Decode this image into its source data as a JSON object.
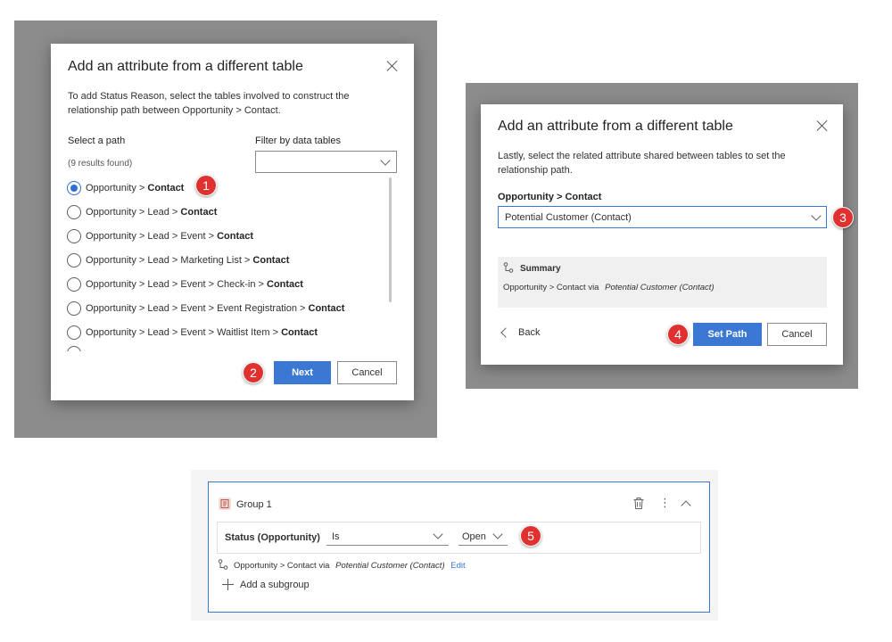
{
  "dialog1": {
    "title": "Add an attribute from a different table",
    "description_line1": "To add Status Reason, select the tables involved to construct the",
    "description_line2": "relationship path between Opportunity > Contact.",
    "select_path_label": "Select a path",
    "results_count": "(9 results found)",
    "filter_label": "Filter by data tables",
    "filter_value": "",
    "paths": [
      {
        "prefix": "Opportunity > ",
        "target": "Contact",
        "checked": true
      },
      {
        "prefix": "Opportunity > Lead > ",
        "target": "Contact",
        "checked": false
      },
      {
        "prefix": "Opportunity > Lead > Event > ",
        "target": "Contact",
        "checked": false
      },
      {
        "prefix": "Opportunity > Lead > Marketing List > ",
        "target": "Contact",
        "checked": false
      },
      {
        "prefix": "Opportunity > Lead > Event > Check-in > ",
        "target": "Contact",
        "checked": false
      },
      {
        "prefix": "Opportunity > Lead > Event > Event Registration > ",
        "target": "Contact",
        "checked": false
      },
      {
        "prefix": "Opportunity > Lead > Event > Waitlist Item > ",
        "target": "Contact",
        "checked": false
      }
    ],
    "next_label": "Next",
    "cancel_label": "Cancel"
  },
  "dialog2": {
    "title": "Add an attribute from a different table",
    "description_line1": "Lastly, select the related attribute shared between tables to set the",
    "description_line2": "relationship path.",
    "field_label": "Opportunity > Contact",
    "field_value": "Potential Customer (Contact)",
    "summary_title": "Summary",
    "summary_prefix": "Opportunity > Contact via",
    "summary_value": "Potential Customer (Contact)",
    "back_label": "Back",
    "set_path_label": "Set Path",
    "cancel_label": "Cancel"
  },
  "group": {
    "title": "Group 1",
    "field": "Status (Opportunity)",
    "operator": "Is",
    "value": "Open",
    "path_prefix": "Opportunity > Contact via",
    "path_value": "Potential Customer (Contact)",
    "edit_label": "Edit",
    "add_subgroup_label": "Add a subgroup"
  },
  "callouts": [
    "1",
    "2",
    "3",
    "4",
    "5"
  ],
  "colors": {
    "accent": "#3b78d4",
    "callout": "#e03131",
    "backdrop": "#8c8c8c"
  }
}
